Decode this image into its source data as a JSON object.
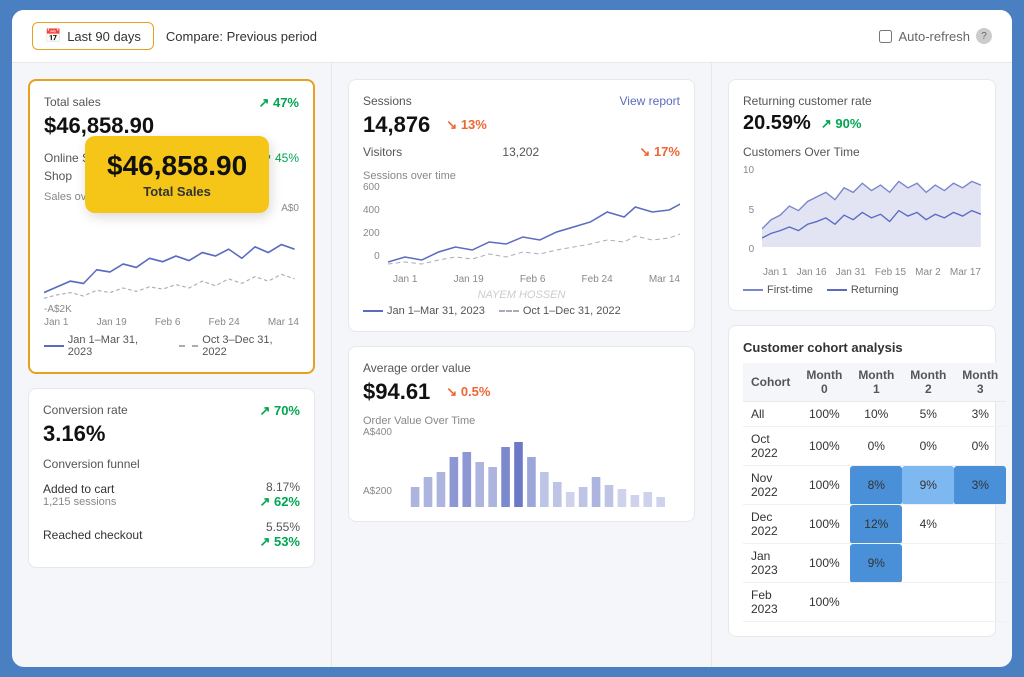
{
  "topbar": {
    "period_btn": "Last 90 days",
    "compare_btn": "Compare: Previous period",
    "auto_refresh": "Auto-refresh",
    "calendar_icon": "📅"
  },
  "total_sales": {
    "label": "Total sales",
    "value": "$46,858.90",
    "change": "47%",
    "change_dir": "up",
    "tooltip_value": "$46,858.90",
    "tooltip_label": "Total Sales",
    "online_label": "Online S...",
    "shop_label": "Shop",
    "sales_over_label": "Sales over...",
    "legend_1": "Jan 1–Mar 31, 2023",
    "legend_2": "Oct 3–Dec 31, 2022",
    "y_min": "-A$2K",
    "y_zero": "A$0"
  },
  "conversion": {
    "label": "Conversion rate",
    "value": "3.16%",
    "change": "70%",
    "change_dir": "up",
    "funnel_title": "Conversion funnel",
    "funnel_rows": [
      {
        "label": "Added to cart",
        "sub": "1,215 sessions",
        "pct": "8.17%",
        "change": "62%",
        "change_dir": "up"
      },
      {
        "label": "Reached checkout",
        "sub": "",
        "pct": "5.55%",
        "change": "53%",
        "change_dir": "up"
      }
    ]
  },
  "sessions": {
    "label": "Sessions",
    "value": "14,876",
    "change": "13%",
    "change_dir": "down",
    "view_report": "View report",
    "visitors_label": "Visitors",
    "visitors_value": "13,202",
    "visitors_change": "17%",
    "visitors_change_dir": "down",
    "chart_label": "Sessions over time",
    "y_max": "600",
    "y_mid": "400",
    "y_low": "200",
    "y_zero": "0",
    "x_labels": [
      "Jan 1",
      "Jan 19",
      "Feb 6",
      "Feb 24",
      "Mar 14"
    ],
    "legend_1": "Jan 1–Mar 31, 2023",
    "legend_2": "Oct 1–Dec 31, 2022"
  },
  "avg_order": {
    "label": "Average order value",
    "value": "$94.61",
    "change": "0.5%",
    "change_dir": "down",
    "chart_label": "Order Value Over Time",
    "y_high": "A$400",
    "y_low": "A$200"
  },
  "returning_customer": {
    "label": "Returning customer rate",
    "value": "20.59%",
    "change": "90%",
    "change_dir": "up",
    "chart_title": "Customers Over Time",
    "y_max": "10",
    "y_mid": "5",
    "y_zero": "0",
    "x_labels": [
      "Jan 1",
      "Jan 16",
      "Jan 31",
      "Feb 15",
      "Mar 2",
      "Mar 17"
    ],
    "legend_first": "First-time",
    "legend_returning": "Returning"
  },
  "cohort": {
    "title": "Customer cohort analysis",
    "headers": [
      "Cohort",
      "Month 0",
      "Month 1",
      "Month 2",
      "Month 3"
    ],
    "rows": [
      {
        "cohort": "All",
        "m0": "100%",
        "m1": "10%",
        "m2": "5%",
        "m3": "3%",
        "m1_hl": false,
        "m2_hl": false
      },
      {
        "cohort": "Oct 2022",
        "m0": "100%",
        "m1": "0%",
        "m2": "0%",
        "m3": "0%",
        "m1_hl": false,
        "m2_hl": false
      },
      {
        "cohort": "Nov 2022",
        "m0": "100%",
        "m1": "8%",
        "m2": "9%",
        "m3": "3%",
        "m1_hl": true,
        "m2_hl": true
      },
      {
        "cohort": "Dec 2022",
        "m0": "100%",
        "m1": "12%",
        "m2": "4%",
        "m3": "",
        "m1_hl": true,
        "m2_hl": false
      },
      {
        "cohort": "Jan 2023",
        "m0": "100%",
        "m1": "9%",
        "m2": "",
        "m3": "",
        "m1_hl": true,
        "m2_hl": false
      },
      {
        "cohort": "Feb 2023",
        "m0": "100%",
        "m1": "",
        "m2": "",
        "m3": "",
        "m1_hl": false,
        "m2_hl": false
      }
    ]
  }
}
